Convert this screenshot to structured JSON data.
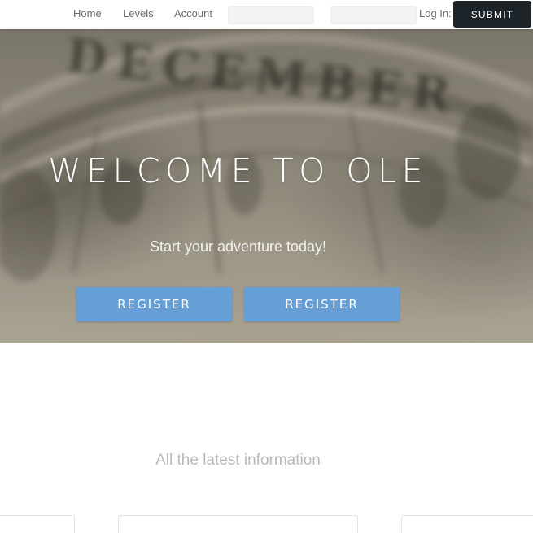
{
  "nav": {
    "links": [
      "Home",
      "Levels",
      "Account"
    ],
    "login_label": "Log In:",
    "username_value": "",
    "password_value": "",
    "submit_label": "SUBMIT"
  },
  "hero": {
    "background_text": "DECEMBER",
    "title": "WELCOME TO OLE",
    "subtitle": "Start your adventure today!",
    "buttons": [
      "REGISTER",
      "REGISTER"
    ]
  },
  "content": {
    "heading": "All the latest information",
    "card_count": 3
  },
  "colors": {
    "primary_button": "#659fd6",
    "submit_button": "#1c2329",
    "nav_text": "#6b6b6b",
    "heading_text": "#b8b8b8"
  }
}
